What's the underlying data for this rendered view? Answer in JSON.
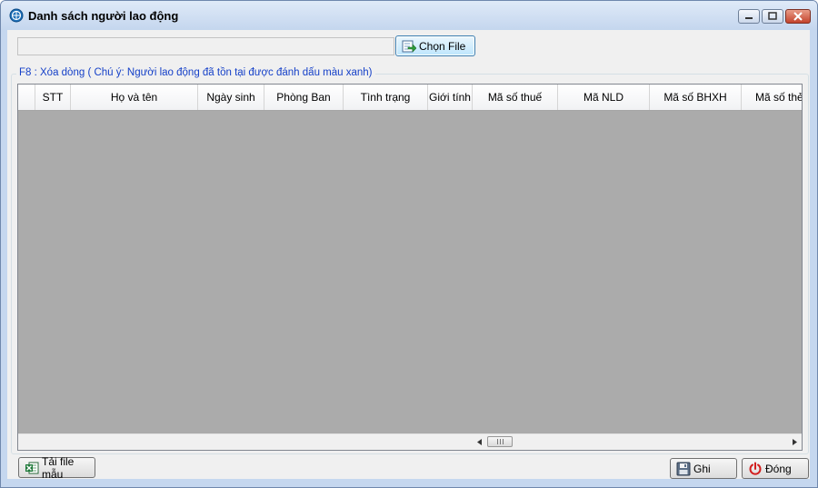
{
  "window": {
    "title": "Danh sách người lao động",
    "app_icon": "app-globe-icon"
  },
  "file_picker": {
    "path_value": "",
    "choose_label": "Chọn File",
    "choose_icon": "import-file-icon"
  },
  "group": {
    "caption": "F8 : Xóa dòng ( Chú ý: Người lao động đã tồn tại được đánh dấu màu xanh)",
    "caption_color": "#1540c8"
  },
  "grid": {
    "columns": [
      "",
      "STT",
      "Họ và tên",
      "Ngày sinh",
      "Phòng Ban",
      "Tình trạng",
      "Giới tính",
      "Mã số thuế",
      "Mã NLD",
      "Mã số BHXH",
      "Mã số thẻ"
    ],
    "rows": []
  },
  "footer": {
    "template_label": "Tải file mẫu",
    "template_icon": "excel-icon",
    "save_label": "Ghi",
    "save_icon": "floppy-disk-icon",
    "close_label": "Đóng",
    "close_icon": "power-icon"
  }
}
